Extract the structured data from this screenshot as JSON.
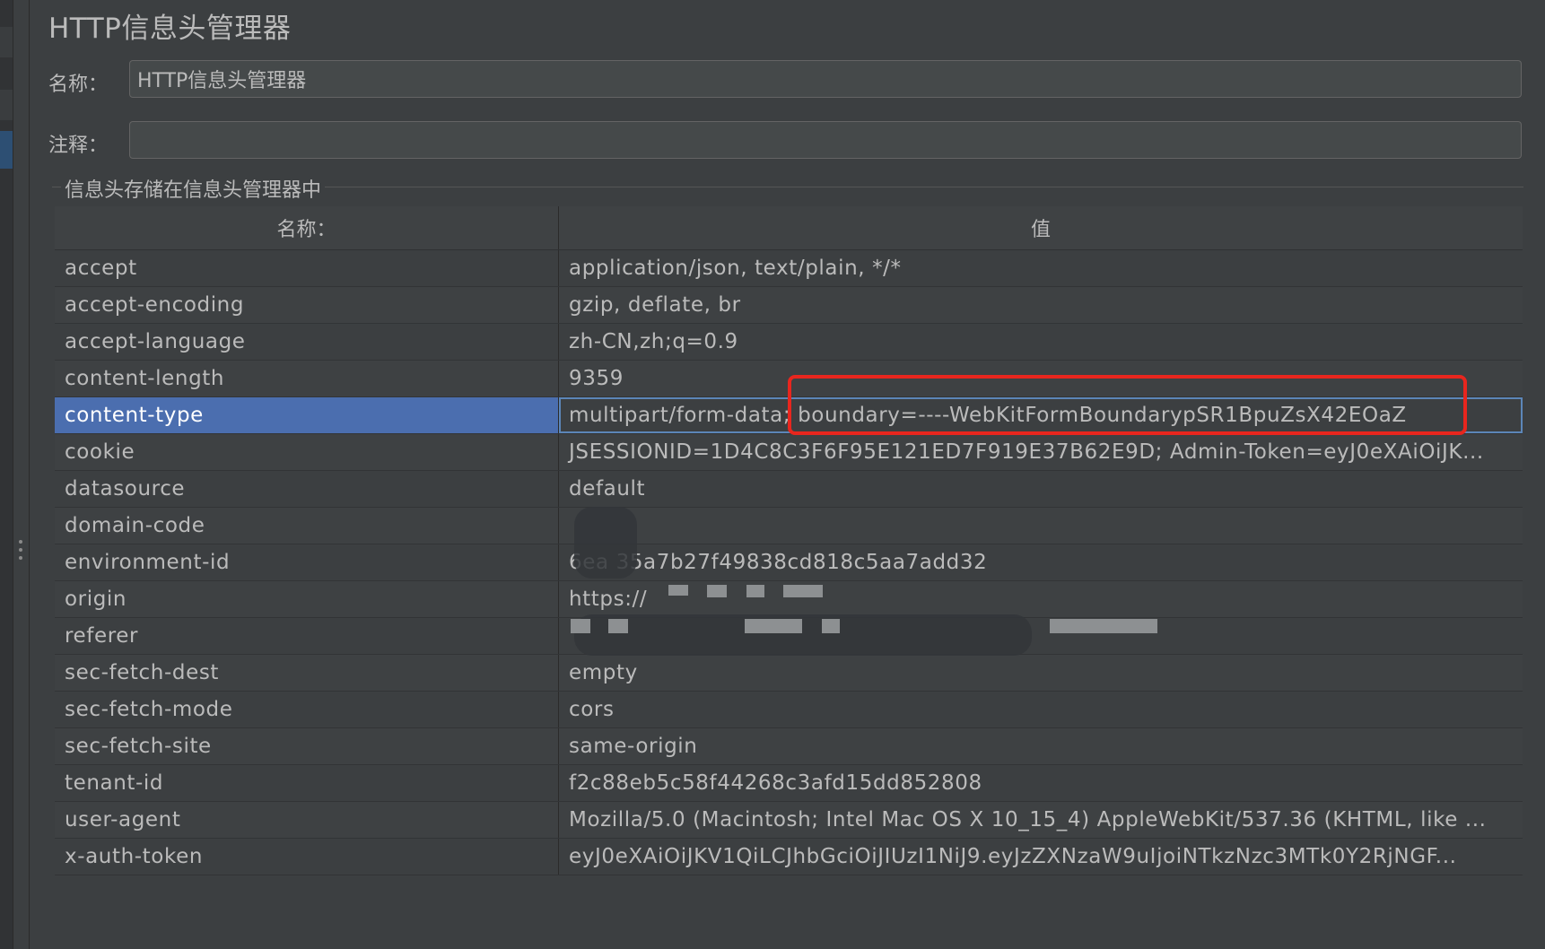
{
  "panel": {
    "title": "HTTP信息头管理器",
    "name_label": "名称：",
    "name_value": "HTTP信息头管理器",
    "comment_label": "注释：",
    "comment_value": "",
    "group_title": "信息头存储在信息头管理器中"
  },
  "table": {
    "columns": [
      "名称：",
      "值"
    ],
    "selected_row": "content-type",
    "rows": [
      {
        "name": "accept",
        "value": "application/json, text/plain, */*"
      },
      {
        "name": "accept-encoding",
        "value": "gzip, deflate, br"
      },
      {
        "name": "accept-language",
        "value": "zh-CN,zh;q=0.9"
      },
      {
        "name": "content-length",
        "value": "9359"
      },
      {
        "name": "content-type",
        "value": "multipart/form-data; boundary=----WebKitFormBoundarypSR1BpuZsX42EOaZ"
      },
      {
        "name": "cookie",
        "value": "JSESSIONID=1D4C8C3F6F95E121ED7F919E37B62E9D; Admin-Token=eyJ0eXAiOiJK..."
      },
      {
        "name": "datasource",
        "value": "default"
      },
      {
        "name": "domain-code",
        "value": ""
      },
      {
        "name": "environment-id",
        "value": "6ea 35a7b27f49838cd818c5aa7add32"
      },
      {
        "name": "origin",
        "value": "https://"
      },
      {
        "name": "referer",
        "value": ""
      },
      {
        "name": "sec-fetch-dest",
        "value": "empty"
      },
      {
        "name": "sec-fetch-mode",
        "value": "cors"
      },
      {
        "name": "sec-fetch-site",
        "value": "same-origin"
      },
      {
        "name": "tenant-id",
        "value": "f2c88eb5c58f44268c3afd15dd852808"
      },
      {
        "name": "user-agent",
        "value": "Mozilla/5.0 (Macintosh; Intel Mac OS X 10_15_4) AppleWebKit/537.36 (KHTML, like ..."
      },
      {
        "name": "x-auth-token",
        "value": "eyJ0eXAiOiJKV1QiLCJhbGciOiJIUzI1NiJ9.eyJzZXNzaW9uIjoiNTkzNzc3MTk0Y2RjNGF..."
      }
    ]
  },
  "colors": {
    "background": "#3c3f41",
    "selection": "#4b6eaf",
    "highlight_box": "#e8261e"
  }
}
